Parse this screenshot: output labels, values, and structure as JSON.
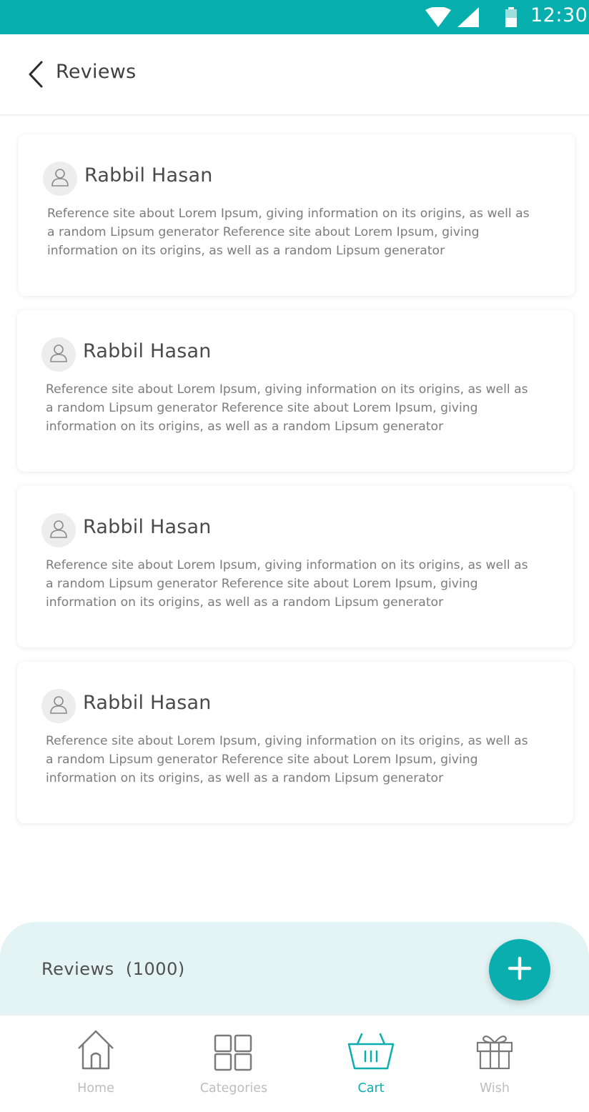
{
  "status_bar": {
    "time": "12:30",
    "color": "#06aeae"
  },
  "header": {
    "title": "Reviews",
    "back_icon": "chevron-left-icon"
  },
  "reviews": [
    {
      "name": "Rabbil Hasan",
      "text": "Reference site about Lorem Ipsum, giving information on its origins, as well as a random Lipsum generator Reference site about Lorem Ipsum, giving information on its origins, as well as a random Lipsum generator"
    },
    {
      "name": "Rabbil Hasan",
      "text": "Reference site about Lorem Ipsum, giving information on its origins, as well as a random Lipsum generator Reference site about Lorem Ipsum, giving information on its origins, as well as a random Lipsum generator"
    },
    {
      "name": "Rabbil Hasan",
      "text": "Reference site about Lorem Ipsum, giving information on its origins, as well as a random Lipsum generator Reference site about Lorem Ipsum, giving information on its origins, as well as a random Lipsum generator"
    },
    {
      "name": "Rabbil Hasan",
      "text": "Reference site about Lorem Ipsum, giving information on its origins, as well as a random Lipsum generator Reference site about Lorem Ipsum, giving information on its origins, as well as a random Lipsum generator"
    }
  ],
  "summary": {
    "label": "Reviews",
    "count": "(1000)",
    "add_icon": "plus-icon"
  },
  "nav": {
    "items": [
      {
        "label": "Home",
        "icon": "home-icon"
      },
      {
        "label": "Categories",
        "icon": "grid-icon"
      },
      {
        "label": "Cart",
        "icon": "basket-icon"
      },
      {
        "label": "Wish",
        "icon": "gift-icon"
      }
    ],
    "active": "Cart",
    "accent": "#0aaeae"
  }
}
